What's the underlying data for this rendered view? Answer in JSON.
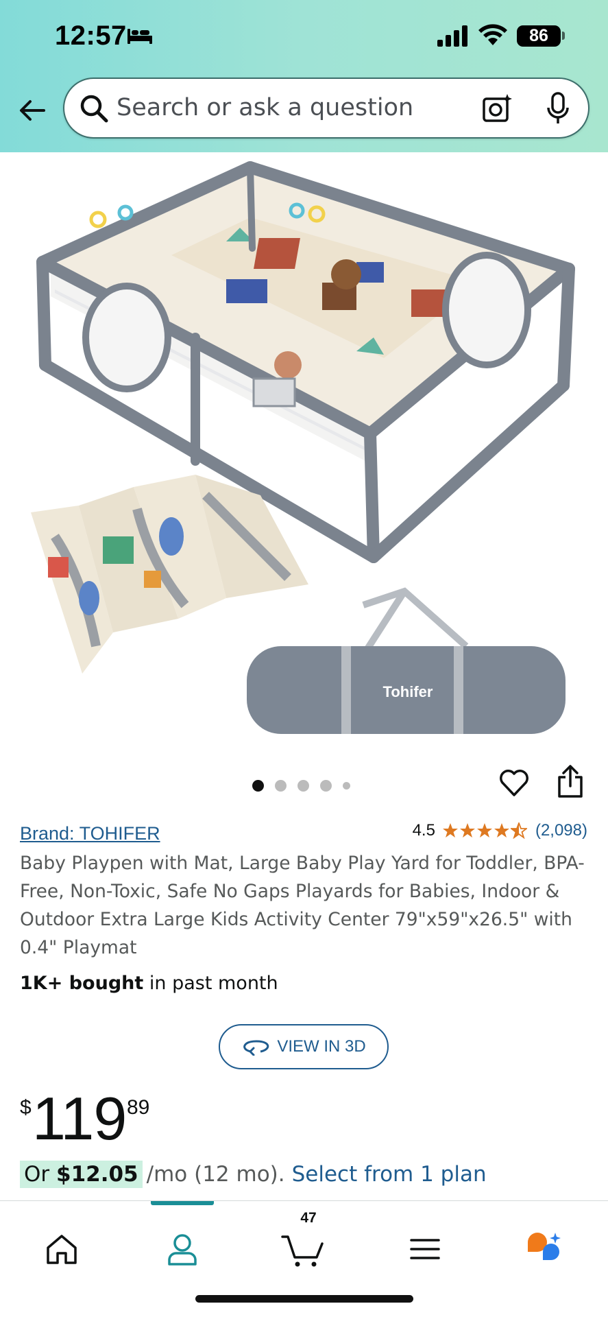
{
  "status_bar": {
    "time": "12:57",
    "battery": "86"
  },
  "search": {
    "placeholder": "Search or ask a question"
  },
  "gallery": {
    "image_count": 5,
    "active_index": 0,
    "mat_logo_text": "Tohifer"
  },
  "product": {
    "brand": "Brand: TOHIFER",
    "rating": "4.5",
    "rating_value": 4.5,
    "rating_count": "(2,098)",
    "title": "Baby Playpen with Mat, Large Baby Play Yard for Toddler, BPA-Free, Non-Toxic, Safe No Gaps Playards for Babies, Indoor & Outdoor Extra Large Kids Activity Center 79\"x59\"x26.5\" with 0.4\" Playmat",
    "bought_bold": "1K+ bought",
    "bought_rest": " in past month",
    "view_3d_label": "VIEW IN 3D",
    "price_symbol": "$",
    "price_whole": "119",
    "price_fraction": "89",
    "monthly_prefix": "Or ",
    "monthly_amount": "$12.05",
    "monthly_rest": "/mo (12 mo).",
    "monthly_link": "Select from 1 plan"
  },
  "bottom_nav": {
    "cart_count": "47",
    "active_tab": "account"
  },
  "colors": {
    "link": "#1f5c8f",
    "accent_teal": "#1a8e96",
    "star": "#de7921",
    "highlight_green": "#ccf0e0"
  }
}
